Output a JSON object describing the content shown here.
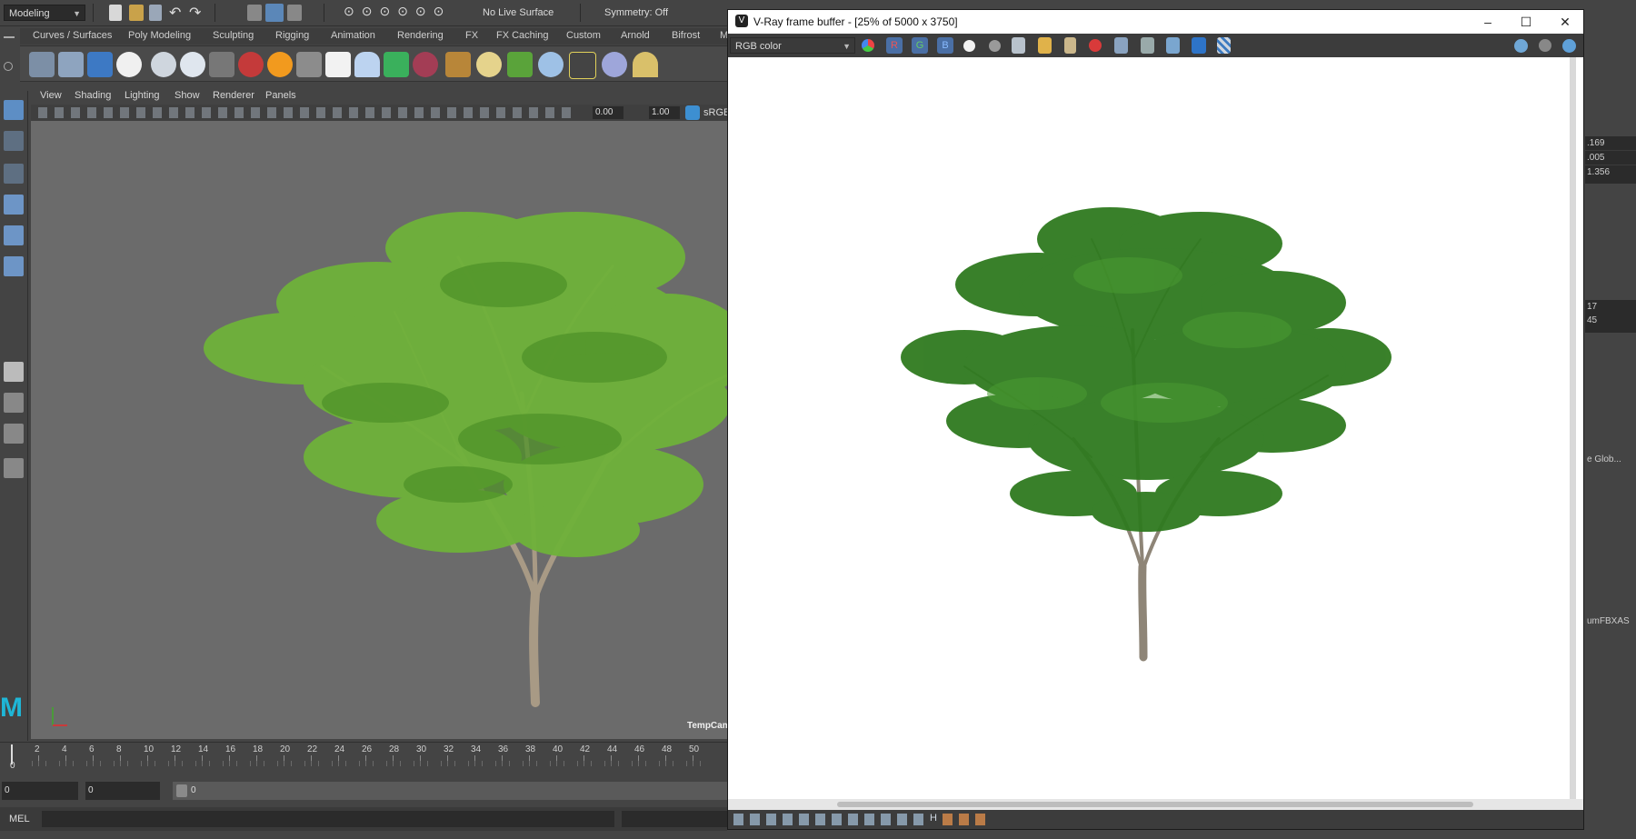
{
  "maya": {
    "mode_menu": "Modeling",
    "live_surface": "No Live Surface",
    "symmetry": "Symmetry: Off",
    "shelf_tabs": [
      "Curves / Surfaces",
      "Poly Modeling",
      "Sculpting",
      "Rigging",
      "Animation",
      "Rendering",
      "FX",
      "FX Caching",
      "Custom",
      "Arnold",
      "Bifrost",
      "M"
    ],
    "panel_menus": [
      "View",
      "Shading",
      "Lighting",
      "Show",
      "Renderer",
      "Panels"
    ],
    "exposure_value": "0.00",
    "gamma_value": "1.00",
    "color_space": "sRGB",
    "camera_label": "TempCam",
    "timeline_ticks": [
      "2",
      "4",
      "6",
      "8",
      "10",
      "12",
      "14",
      "16",
      "18",
      "20",
      "22",
      "24",
      "26",
      "28",
      "30",
      "32",
      "34",
      "36",
      "38",
      "40",
      "42",
      "44",
      "46",
      "48",
      "50"
    ],
    "timeline_start": "0",
    "range_start": "0",
    "range_end": "0",
    "range_field": "0",
    "cmd_label": "MEL",
    "right_values": [
      ".169",
      ".005",
      "1.356",
      "17",
      "45",
      "e Glob...",
      "umFBXAS"
    ],
    "maya_logo": "M"
  },
  "vfb": {
    "title": "V-Ray frame buffer - [25% of 5000 x 3750]",
    "channel": "RGB color",
    "channel_buttons": [
      "R",
      "G",
      "B"
    ],
    "status_icon_h": "H"
  },
  "colors": {
    "maya_bg": "#444444",
    "viewport_bg": "#6b6b6b",
    "foliage_light": "#6fb23a",
    "foliage_dark": "#2f7a1f",
    "trunk": "#9a8a78",
    "channel_active": "#4a6fa5"
  }
}
